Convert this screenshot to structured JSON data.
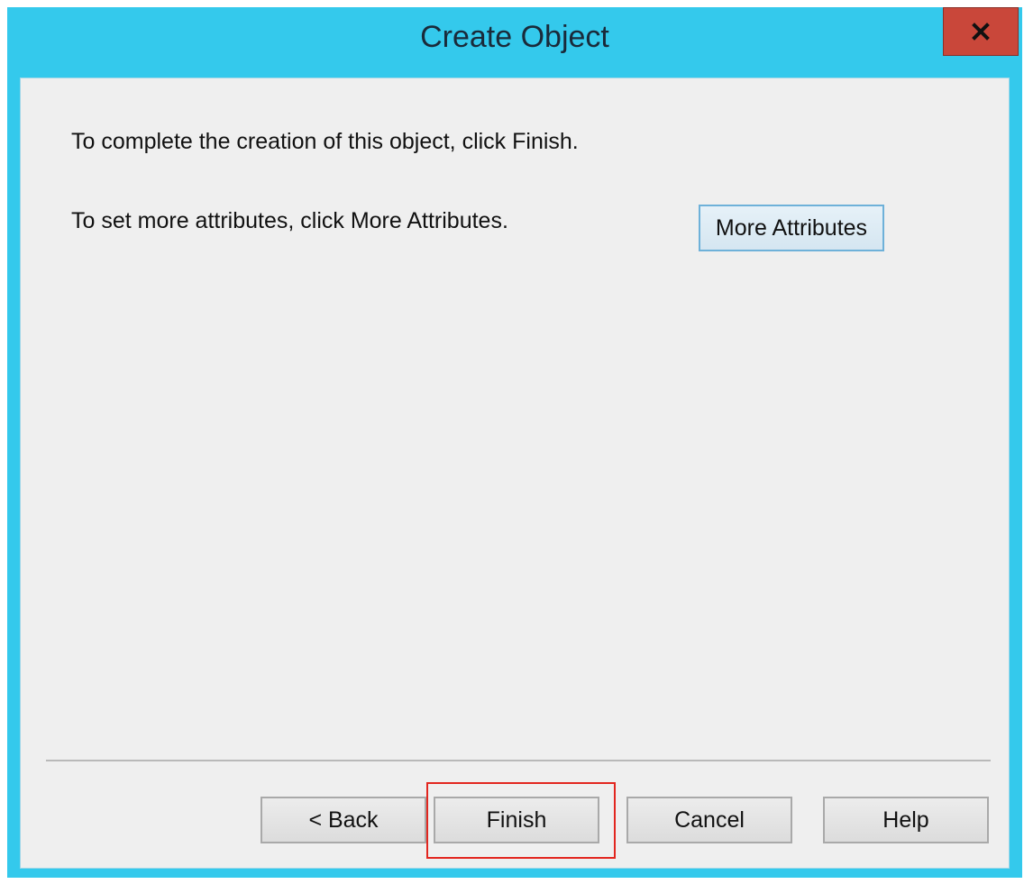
{
  "window": {
    "title": "Create Object",
    "close_icon": "close-icon"
  },
  "content": {
    "line1": "To complete the creation of this object, click Finish.",
    "line2": "To set more attributes, click More Attributes.",
    "more_attributes_label": "More Attributes"
  },
  "footer": {
    "back_label": "< Back",
    "finish_label": "Finish",
    "cancel_label": "Cancel",
    "help_label": "Help"
  },
  "colors": {
    "titlebar": "#34c9ec",
    "close_button": "#c9473a",
    "client_background": "#efefef",
    "highlight": "#e2261f"
  }
}
